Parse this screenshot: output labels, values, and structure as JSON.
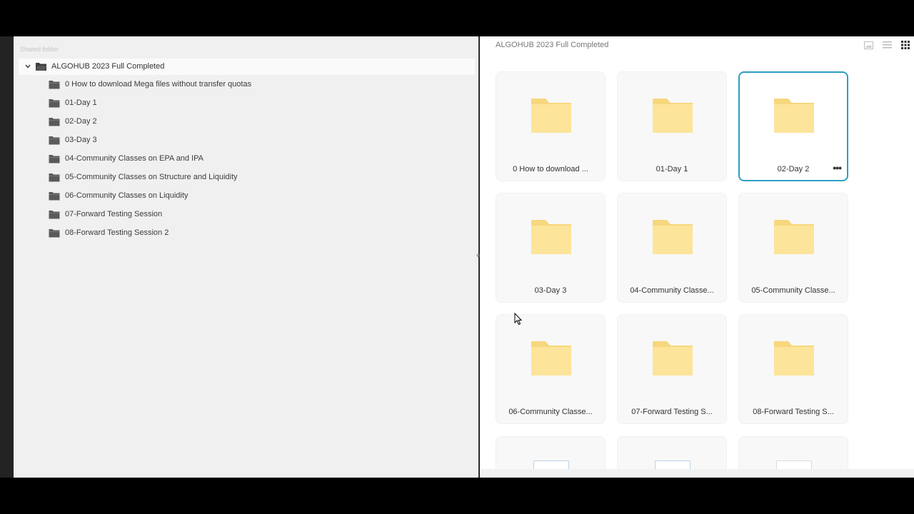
{
  "sidebar": {
    "heading": "Shared folder",
    "root": {
      "label": "ALGOHUB 2023 Full Completed",
      "expanded": true
    },
    "items": [
      {
        "label": "0 How to download Mega files without transfer quotas"
      },
      {
        "label": "01-Day 1"
      },
      {
        "label": "02-Day 2"
      },
      {
        "label": "03-Day 3"
      },
      {
        "label": "04-Community Classes on EPA and IPA"
      },
      {
        "label": "05-Community Classes on Structure and Liquidity"
      },
      {
        "label": "06-Community Classes on Liquidity"
      },
      {
        "label": "07-Forward Testing Session"
      },
      {
        "label": "08-Forward Testing Session 2"
      }
    ]
  },
  "collapse_button": {
    "glyph": "«"
  },
  "main": {
    "title": "ALGOHUB 2023 Full Completed",
    "view_icons": [
      "image-view-icon",
      "list-view-icon",
      "grid-view-icon"
    ],
    "active_view": "grid",
    "cards": [
      {
        "label": "0 How to download ..."
      },
      {
        "label": "01-Day 1"
      },
      {
        "label": "02-Day 2",
        "selected": true,
        "more": "•••"
      },
      {
        "label": "03-Day 3"
      },
      {
        "label": "04-Community Classe..."
      },
      {
        "label": "05-Community Classe..."
      },
      {
        "label": "06-Community Classe..."
      },
      {
        "label": "07-Forward Testing S..."
      },
      {
        "label": "08-Forward Testing S..."
      }
    ]
  },
  "colors": {
    "folder_fill": "#fce49a",
    "folder_tab": "#f7d77e",
    "selection_border": "#2b9fc4",
    "tree_folder": "#5a5a5a"
  }
}
